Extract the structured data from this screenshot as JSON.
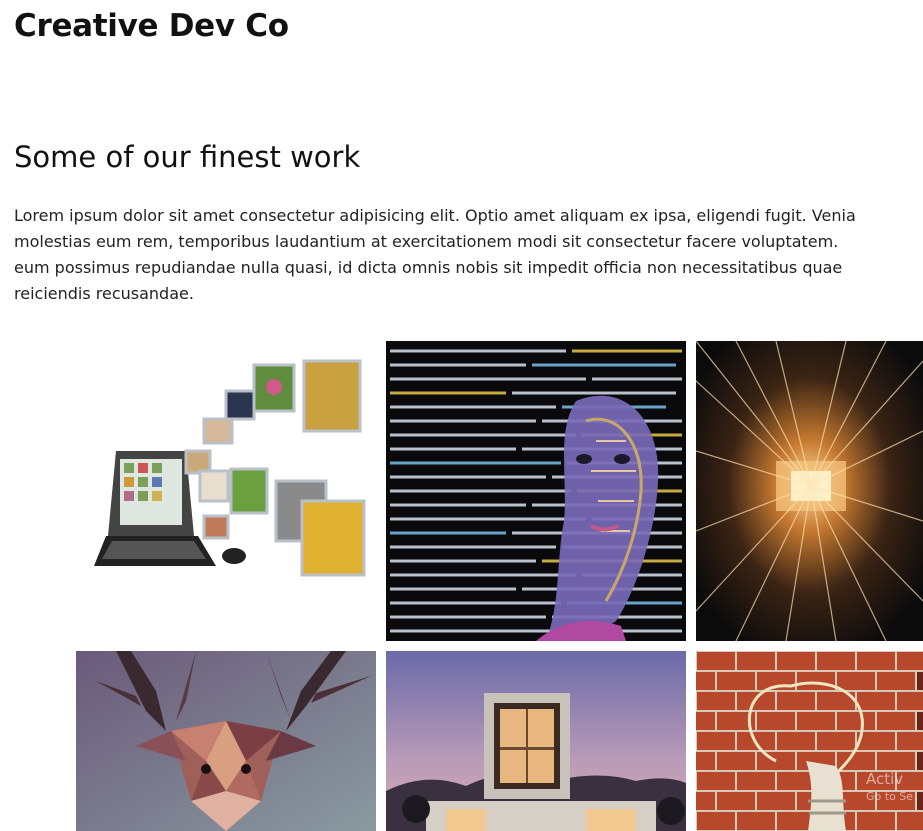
{
  "header": {
    "brand": "Creative Dev Co"
  },
  "main": {
    "title": "Some of our finest work",
    "intro_lines": [
      "Lorem ipsum dolor sit amet consectetur adipisicing elit. Optio amet aliquam ex ipsa, eligendi fugit. Venia",
      "molestias eum rem, temporibus laudantium at exercitationem modi sit consectetur facere voluptatem.",
      "eum possimus repudiandae nulla quasi, id dicta omnis nobis sit impedit officia non necessitatibus quae",
      "reiciendis recusandae."
    ]
  },
  "gallery": {
    "items": [
      {
        "subject": "laptop-with-photos"
      },
      {
        "subject": "code-face"
      },
      {
        "subject": "light-tunnel"
      },
      {
        "subject": "low-poly-deer"
      },
      {
        "subject": "modern-house"
      },
      {
        "subject": "lightbulb-brick-wall"
      }
    ]
  },
  "watermark": {
    "line1": "Activ",
    "line2": "Go to Se"
  },
  "colors": {
    "text": "#111111",
    "background": "#ffffff"
  }
}
